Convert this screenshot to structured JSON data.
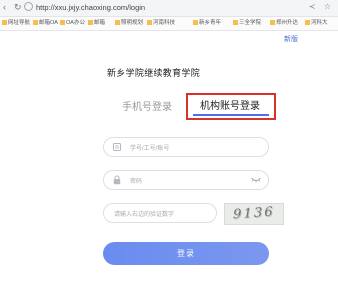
{
  "browser": {
    "url": "http://xxu.jxjy.chaoxing.com/login",
    "bookmarks": [
      "网址导航",
      "邮箱OA",
      "OA办公",
      "邮箱",
      "照明规划",
      "河南科技",
      "新乡青年",
      "三全学院",
      "郑州升达",
      "河科大"
    ]
  },
  "page": {
    "top_right_link": "新版",
    "school_title": "新乡学院继续教育学院",
    "tabs": {
      "phone": "手机号登录",
      "org": "机构账号登录"
    },
    "fields": {
      "student_id_placeholder": "学号/工号/账号",
      "password_placeholder": "密码",
      "captcha_placeholder": "请输入右边的验证数字"
    },
    "captcha_text": "9136",
    "login_button": "登录"
  },
  "colors": {
    "accent": "#4e6ef2",
    "highlight": "#d7312b",
    "button": "#6f8ff0"
  }
}
